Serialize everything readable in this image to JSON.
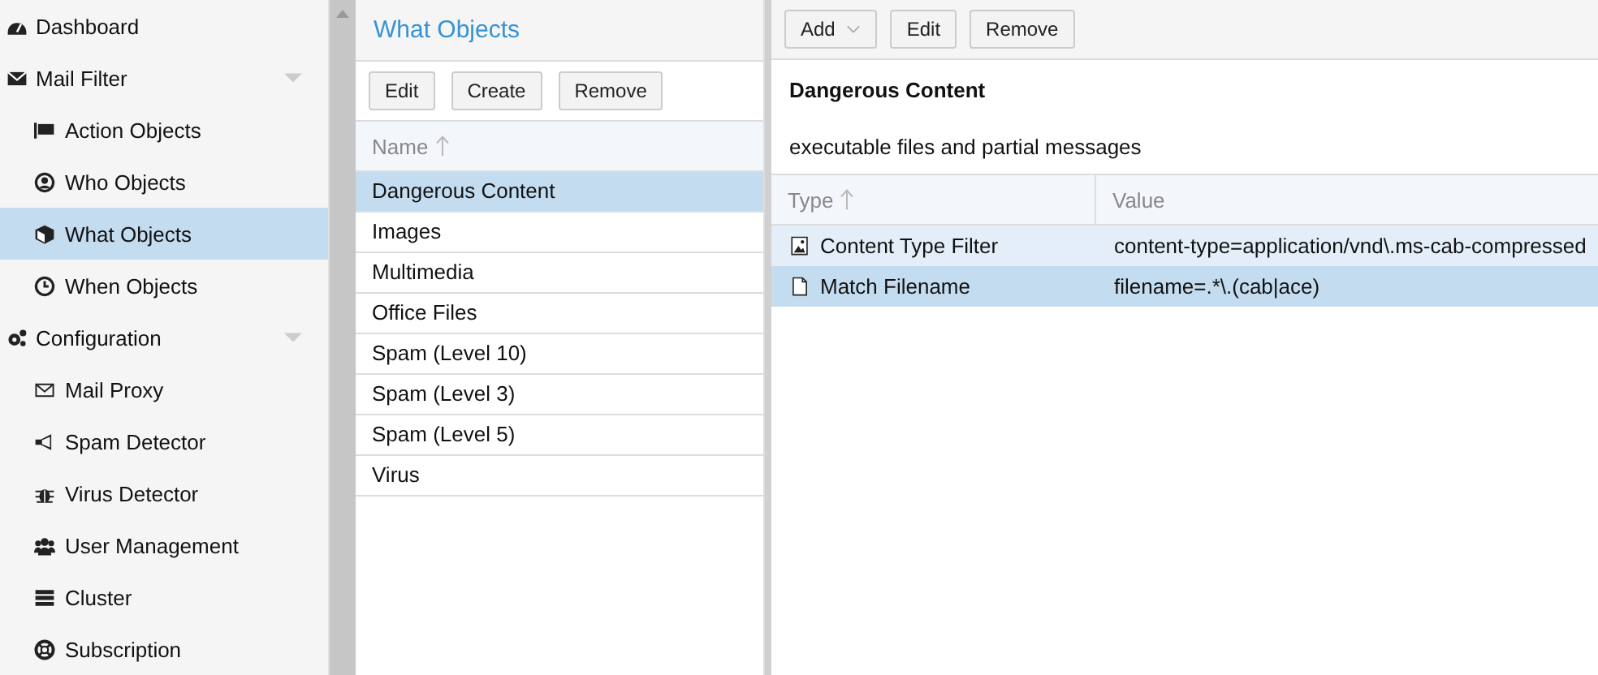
{
  "sidebar": {
    "items": [
      {
        "label": "Dashboard",
        "selected": false
      },
      {
        "label": "Mail Filter",
        "selected": false,
        "expanded": true,
        "children": [
          {
            "label": "Action Objects",
            "selected": false
          },
          {
            "label": "Who Objects",
            "selected": false
          },
          {
            "label": "What Objects",
            "selected": true
          },
          {
            "label": "When Objects",
            "selected": false
          }
        ]
      },
      {
        "label": "Configuration",
        "selected": false,
        "expanded": true,
        "children": [
          {
            "label": "Mail Proxy",
            "selected": false
          },
          {
            "label": "Spam Detector",
            "selected": false
          },
          {
            "label": "Virus Detector",
            "selected": false
          },
          {
            "label": "User Management",
            "selected": false
          },
          {
            "label": "Cluster",
            "selected": false
          },
          {
            "label": "Subscription",
            "selected": false
          }
        ]
      }
    ]
  },
  "objects_panel": {
    "title": "What Objects",
    "buttons": [
      "Edit",
      "Create",
      "Remove"
    ],
    "column": "Name",
    "rows": [
      {
        "name": "Dangerous Content",
        "selected": true
      },
      {
        "name": "Images",
        "selected": false
      },
      {
        "name": "Multimedia",
        "selected": false
      },
      {
        "name": "Office Files",
        "selected": false
      },
      {
        "name": "Spam (Level 10)",
        "selected": false
      },
      {
        "name": "Spam (Level 3)",
        "selected": false
      },
      {
        "name": "Spam (Level 5)",
        "selected": false
      },
      {
        "name": "Virus",
        "selected": false
      }
    ]
  },
  "detail_panel": {
    "buttons": [
      {
        "label": "Add",
        "kind": "dropdown"
      },
      {
        "label": "Edit",
        "kind": "plain"
      },
      {
        "label": "Remove",
        "kind": "plain"
      }
    ],
    "title": "Dangerous Content",
    "description": "executable files and partial messages",
    "columns": [
      "Type",
      "Value"
    ],
    "rows": [
      {
        "type": "Content Type Filter",
        "value": "content-type=application/vnd\\.ms-cab-compressed",
        "kind": "image",
        "selected": false,
        "hovered": true
      },
      {
        "type": "Match Filename",
        "value": "filename=.*\\.(cab|ace)",
        "kind": "file",
        "selected": true,
        "hovered": false
      }
    ]
  }
}
